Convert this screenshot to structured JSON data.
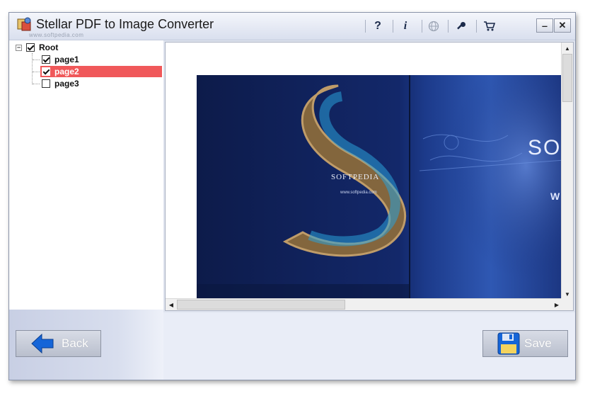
{
  "window": {
    "title": "Stellar PDF to Image Converter",
    "watermark": "www.softpedia.com"
  },
  "toolbar": {
    "help_glyph": "?",
    "info_glyph": "i",
    "globe_icon": "globe-icon",
    "key_icon": "key-icon",
    "cart_icon": "cart-icon",
    "minimize_glyph": "‒",
    "close_glyph": "✕"
  },
  "tree": {
    "root": {
      "label": "Root",
      "checked": true,
      "expander": "⊟"
    },
    "items": [
      {
        "label": "page1",
        "checked": true,
        "selected": false
      },
      {
        "label": "page2",
        "checked": true,
        "selected": true
      },
      {
        "label": "page3",
        "checked": false,
        "selected": false
      }
    ]
  },
  "preview": {
    "brand_text": "SO",
    "brand_text_small": "W",
    "softpedia_text": "SOFTPEDIA",
    "url_text": "www.softpedia.com"
  },
  "buttons": {
    "back_label": "Back",
    "save_label": "Save"
  },
  "colors": {
    "selection": "#f0585a",
    "accent_blue": "#1565d8"
  }
}
